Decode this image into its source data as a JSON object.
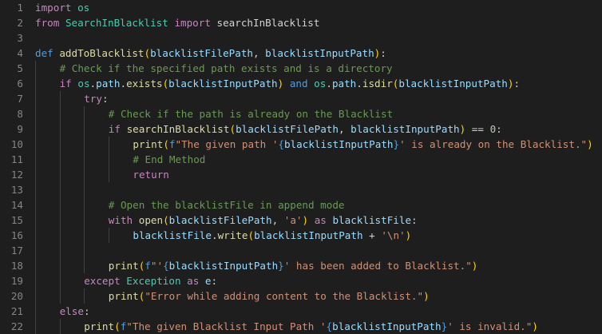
{
  "editor": {
    "lines": [
      {
        "n": "1",
        "indent": 0,
        "tokens": [
          [
            "kw",
            "import"
          ],
          [
            "pl",
            " "
          ],
          [
            "cls",
            "os"
          ]
        ]
      },
      {
        "n": "2",
        "indent": 0,
        "tokens": [
          [
            "kw",
            "from"
          ],
          [
            "pl",
            " "
          ],
          [
            "cls",
            "SearchInBlacklist"
          ],
          [
            "pl",
            " "
          ],
          [
            "kw",
            "import"
          ],
          [
            "pl",
            " searchInBlacklist"
          ]
        ]
      },
      {
        "n": "3",
        "indent": 0,
        "tokens": []
      },
      {
        "n": "4",
        "indent": 0,
        "tokens": [
          [
            "def",
            "def"
          ],
          [
            "pl",
            " "
          ],
          [
            "fn",
            "addToBlacklist"
          ],
          [
            "br1",
            "("
          ],
          [
            "var",
            "blacklistFilePath"
          ],
          [
            "pl",
            ", "
          ],
          [
            "var",
            "blacklistInputPath"
          ],
          [
            "br1",
            ")"
          ],
          [
            "pl",
            ":"
          ]
        ]
      },
      {
        "n": "5",
        "indent": 1,
        "tokens": [
          [
            "cmt",
            "# Check if the specified path exists and is a directory"
          ]
        ]
      },
      {
        "n": "6",
        "indent": 1,
        "tokens": [
          [
            "kw",
            "if"
          ],
          [
            "pl",
            " "
          ],
          [
            "cls",
            "os"
          ],
          [
            "pl",
            "."
          ],
          [
            "var",
            "path"
          ],
          [
            "pl",
            "."
          ],
          [
            "fn",
            "exists"
          ],
          [
            "br1",
            "("
          ],
          [
            "var",
            "blacklistInputPath"
          ],
          [
            "br1",
            ")"
          ],
          [
            "pl",
            " "
          ],
          [
            "def",
            "and"
          ],
          [
            "pl",
            " "
          ],
          [
            "cls",
            "os"
          ],
          [
            "pl",
            "."
          ],
          [
            "var",
            "path"
          ],
          [
            "pl",
            "."
          ],
          [
            "fn",
            "isdir"
          ],
          [
            "br1",
            "("
          ],
          [
            "var",
            "blacklistInputPath"
          ],
          [
            "br1",
            ")"
          ],
          [
            "pl",
            ":"
          ]
        ]
      },
      {
        "n": "7",
        "indent": 2,
        "tokens": [
          [
            "kw",
            "try"
          ],
          [
            "pl",
            ":"
          ]
        ]
      },
      {
        "n": "8",
        "indent": 3,
        "tokens": [
          [
            "cmt",
            "# Check if the path is already on the Blacklist"
          ]
        ]
      },
      {
        "n": "9",
        "indent": 3,
        "tokens": [
          [
            "kw",
            "if"
          ],
          [
            "pl",
            " "
          ],
          [
            "fn",
            "searchInBlacklist"
          ],
          [
            "br1",
            "("
          ],
          [
            "var",
            "blacklistFilePath"
          ],
          [
            "pl",
            ", "
          ],
          [
            "var",
            "blacklistInputPath"
          ],
          [
            "br1",
            ")"
          ],
          [
            "pl",
            " == "
          ],
          [
            "num",
            "0"
          ],
          [
            "pl",
            ":"
          ]
        ]
      },
      {
        "n": "10",
        "indent": 4,
        "tokens": [
          [
            "fn",
            "print"
          ],
          [
            "br1",
            "("
          ],
          [
            "def",
            "f"
          ],
          [
            "str",
            "\"The given path '"
          ],
          [
            "def",
            "{"
          ],
          [
            "var",
            "blacklistInputPath"
          ],
          [
            "def",
            "}"
          ],
          [
            "str",
            "' is already on the Blacklist.\""
          ],
          [
            "br1",
            ")"
          ]
        ]
      },
      {
        "n": "11",
        "indent": 4,
        "tokens": [
          [
            "cmt",
            "# End Method"
          ]
        ]
      },
      {
        "n": "12",
        "indent": 4,
        "tokens": [
          [
            "kw",
            "return"
          ]
        ]
      },
      {
        "n": "13",
        "indent": 3,
        "tokens": []
      },
      {
        "n": "14",
        "indent": 3,
        "tokens": [
          [
            "cmt",
            "# Open the blacklistFile in append mode"
          ]
        ]
      },
      {
        "n": "15",
        "indent": 3,
        "tokens": [
          [
            "kw",
            "with"
          ],
          [
            "pl",
            " "
          ],
          [
            "fn",
            "open"
          ],
          [
            "br1",
            "("
          ],
          [
            "var",
            "blacklistFilePath"
          ],
          [
            "pl",
            ", "
          ],
          [
            "str",
            "'a'"
          ],
          [
            "br1",
            ")"
          ],
          [
            "pl",
            " "
          ],
          [
            "kw",
            "as"
          ],
          [
            "pl",
            " "
          ],
          [
            "var",
            "blacklistFile"
          ],
          [
            "pl",
            ":"
          ]
        ]
      },
      {
        "n": "16",
        "indent": 4,
        "tokens": [
          [
            "var",
            "blacklistFile"
          ],
          [
            "pl",
            "."
          ],
          [
            "fn",
            "write"
          ],
          [
            "br1",
            "("
          ],
          [
            "var",
            "blacklistInputPath"
          ],
          [
            "pl",
            " + "
          ],
          [
            "str",
            "'\\n'"
          ],
          [
            "br1",
            ")"
          ]
        ]
      },
      {
        "n": "17",
        "indent": 3,
        "tokens": []
      },
      {
        "n": "18",
        "indent": 3,
        "tokens": [
          [
            "fn",
            "print"
          ],
          [
            "br1",
            "("
          ],
          [
            "def",
            "f"
          ],
          [
            "str",
            "\"'"
          ],
          [
            "def",
            "{"
          ],
          [
            "var",
            "blacklistInputPath"
          ],
          [
            "def",
            "}"
          ],
          [
            "str",
            "' has been added to Blacklist.\""
          ],
          [
            "br1",
            ")"
          ]
        ]
      },
      {
        "n": "19",
        "indent": 2,
        "tokens": [
          [
            "kw",
            "except"
          ],
          [
            "pl",
            " "
          ],
          [
            "cls",
            "Exception"
          ],
          [
            "pl",
            " "
          ],
          [
            "kw",
            "as"
          ],
          [
            "pl",
            " "
          ],
          [
            "var",
            "e"
          ],
          [
            "pl",
            ":"
          ]
        ]
      },
      {
        "n": "20",
        "indent": 3,
        "tokens": [
          [
            "fn",
            "print"
          ],
          [
            "br1",
            "("
          ],
          [
            "str",
            "\"Error while adding content to the Blacklist.\""
          ],
          [
            "br1",
            ")"
          ]
        ]
      },
      {
        "n": "21",
        "indent": 1,
        "tokens": [
          [
            "kw",
            "else"
          ],
          [
            "pl",
            ":"
          ]
        ]
      },
      {
        "n": "22",
        "indent": 2,
        "tokens": [
          [
            "fn",
            "print"
          ],
          [
            "br1",
            "("
          ],
          [
            "def",
            "f"
          ],
          [
            "str",
            "\"The given Blacklist Input Path '"
          ],
          [
            "def",
            "{"
          ],
          [
            "var",
            "blacklistInputPath"
          ],
          [
            "def",
            "}"
          ],
          [
            "str",
            "' is invalid.\""
          ],
          [
            "br1",
            ")"
          ]
        ]
      }
    ]
  },
  "colors": {
    "background": "#1e1e1e",
    "line_number": "#858585",
    "keyword": "#c586c0",
    "storage": "#569cd6",
    "function": "#dcdcaa",
    "variable": "#9cdcfe",
    "class": "#4ec9b0",
    "string": "#ce9178",
    "comment": "#6a9955",
    "number": "#b5cea8"
  }
}
